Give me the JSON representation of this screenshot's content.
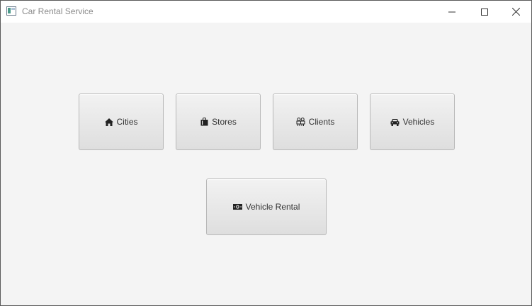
{
  "window": {
    "title": "Car Rental Service"
  },
  "buttons": {
    "cities": {
      "label": "Cities",
      "icon": "home-icon"
    },
    "stores": {
      "label": "Stores",
      "icon": "shopping-bag-icon"
    },
    "clients": {
      "label": "Clients",
      "icon": "users-icon"
    },
    "vehicles": {
      "label": "Vehicles",
      "icon": "car-icon"
    },
    "rental": {
      "label": "Vehicle Rental",
      "icon": "money-icon"
    }
  },
  "colors": {
    "window_bg": "#f4f4f4",
    "button_border": "#b8b8b8",
    "text": "#333333",
    "title_text": "#8a8a8a"
  }
}
